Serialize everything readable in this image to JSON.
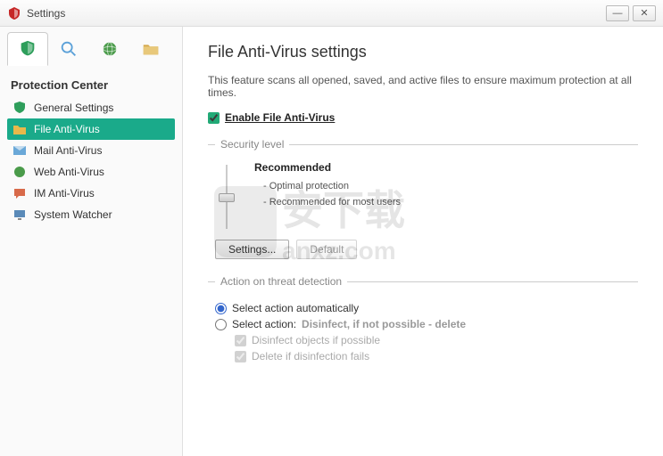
{
  "window": {
    "title": "Settings"
  },
  "sidebar": {
    "section_title": "Protection Center",
    "items": [
      {
        "label": "General Settings"
      },
      {
        "label": "File Anti-Virus"
      },
      {
        "label": "Mail Anti-Virus"
      },
      {
        "label": "Web Anti-Virus"
      },
      {
        "label": "IM Anti-Virus"
      },
      {
        "label": "System Watcher"
      }
    ]
  },
  "main": {
    "heading": "File Anti-Virus settings",
    "description": "This feature scans all opened, saved, and active files to ensure maximum protection at all times.",
    "enable_label": "Enable File Anti-Virus",
    "security": {
      "legend": "Security level",
      "level_name": "Recommended",
      "detail1": "- Optimal protection",
      "detail2": "- Recommended for most users",
      "settings_btn": "Settings...",
      "default_btn": "Default"
    },
    "action": {
      "legend": "Action on threat detection",
      "auto_label": "Select action automatically",
      "select_label": "Select action:",
      "select_hint": "Disinfect, if not possible - delete",
      "sub1": "Disinfect objects if possible",
      "sub2": "Delete if disinfection fails"
    }
  },
  "watermark": "安下载",
  "watermark_sub": "anxz.com"
}
